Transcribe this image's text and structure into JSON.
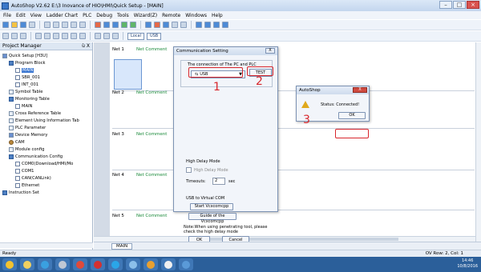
{
  "window": {
    "title": "AutoShop V2.62  E:\\3 Inovance of HIO\\HMI\\Quick Setup - [MAIN]"
  },
  "menu": [
    "File",
    "Edit",
    "View",
    "Ladder Chart",
    "PLC",
    "Debug",
    "Tools",
    "Wizard(Z)",
    "Remote",
    "Windows",
    "Help"
  ],
  "toolbar": {
    "local_label": "Local",
    "usb_label": "USB"
  },
  "project_manager": {
    "title": "Project Manager",
    "close": "ù X",
    "items": [
      {
        "label": "Quick Setup [H3U]",
        "level": 0,
        "icon": "project-icon"
      },
      {
        "label": "Program Block",
        "level": 1,
        "icon": "folder-icon"
      },
      {
        "label": "MAIN",
        "level": 2,
        "icon": "page-icon",
        "selected": true
      },
      {
        "label": "SBR_001",
        "level": 2,
        "icon": "page-icon"
      },
      {
        "label": "INT_001",
        "level": 2,
        "icon": "page-icon"
      },
      {
        "label": "Symbol Table",
        "level": 1,
        "icon": "table-icon"
      },
      {
        "label": "Monitoring Table",
        "level": 1,
        "icon": "folder-icon"
      },
      {
        "label": "MAIN",
        "level": 2,
        "icon": "page-icon"
      },
      {
        "label": "Cross Reference Table",
        "level": 1,
        "icon": "table-icon"
      },
      {
        "label": "Element Using Information Tab",
        "level": 1,
        "icon": "table-icon"
      },
      {
        "label": "PLC Parameter",
        "level": 1,
        "icon": "table-icon"
      },
      {
        "label": "Device Memory",
        "level": 1,
        "icon": "device-icon"
      },
      {
        "label": "CAM",
        "level": 1,
        "icon": "gear-icon"
      },
      {
        "label": "Module config",
        "level": 1,
        "icon": "table-icon"
      },
      {
        "label": "Communication Config",
        "level": 1,
        "icon": "folder-icon"
      },
      {
        "label": "COM0(Download/HMI/Mo",
        "level": 2,
        "icon": "page-icon"
      },
      {
        "label": "COM1",
        "level": 2,
        "icon": "page-icon"
      },
      {
        "label": "CAN(CANLink)",
        "level": 2,
        "icon": "page-icon"
      },
      {
        "label": "Ethernet",
        "level": 2,
        "icon": "page-icon"
      },
      {
        "label": "Instruction Set",
        "level": 0,
        "icon": "folder-icon"
      }
    ]
  },
  "networks": [
    {
      "label": "Net 1",
      "comment": "Net Comment"
    },
    {
      "label": "Net 2",
      "comment": "Net Comment"
    },
    {
      "label": "Net 3",
      "comment": "Net Comment"
    },
    {
      "label": "Net 4",
      "comment": "Net Comment"
    },
    {
      "label": "Net 5",
      "comment": "Net Comment"
    }
  ],
  "comm_dialog": {
    "title": "Communication Setting",
    "close": "X",
    "group_label": "The connection of The PC and PLC",
    "port_value": "USB",
    "test_label": "TEST",
    "high_delay_label": "High Delay Mode",
    "high_delay_check": "High Delay Mode",
    "timeouts_label": "Timeouts:",
    "timeouts_value": "2",
    "timeouts_unit": "sec",
    "usb_vcom_label": "USB to Virtual COM",
    "start_vcom_label": "Start Vcxcomcpp",
    "guide_label": "Guide of the Vcxcomcpp",
    "note": "Note:When using penetrating tool, please check the high delay mode",
    "ok_label": "OK",
    "cancel_label": "Cancel"
  },
  "autoshop_dialog": {
    "title": "AutoShop",
    "close": "X",
    "message": "Status: Connected!",
    "ok_label": "OK"
  },
  "annotations": {
    "n1": "1",
    "n2": "2",
    "n3": "3",
    "color": "#d8262c"
  },
  "tab": {
    "label": "MAIN"
  },
  "status": {
    "left": "Ready",
    "right": "OV Row: 2, Col: 1"
  },
  "tray": {
    "time": "14:46",
    "date": "10/8/2016"
  }
}
